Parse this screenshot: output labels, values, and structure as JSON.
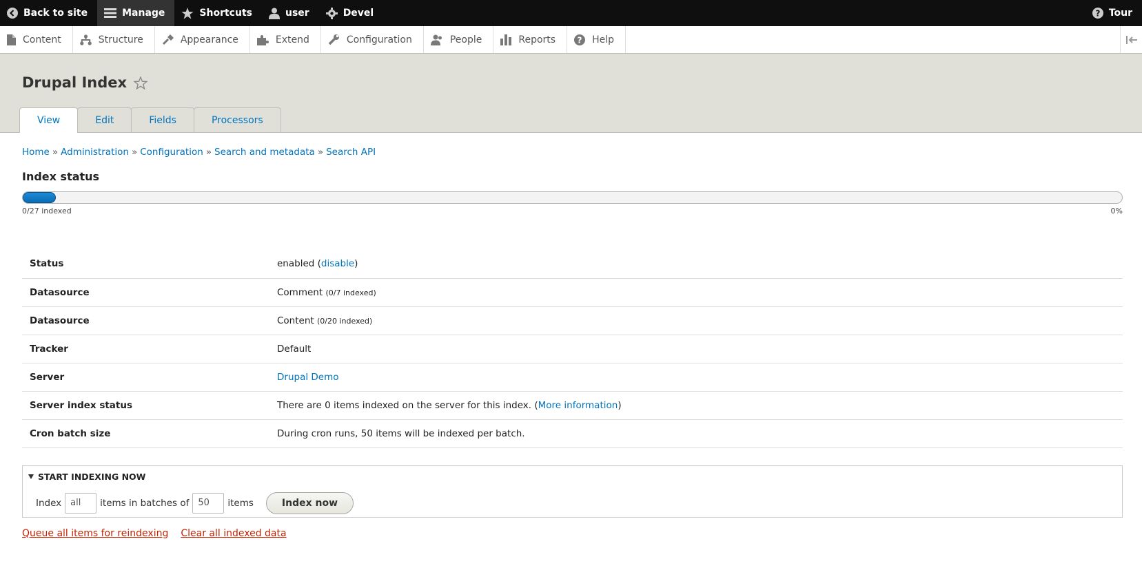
{
  "toolbar": {
    "back": "Back to site",
    "manage": "Manage",
    "shortcuts": "Shortcuts",
    "user": "user",
    "devel": "Devel",
    "tour": "Tour"
  },
  "tray": {
    "items": [
      "Content",
      "Structure",
      "Appearance",
      "Extend",
      "Configuration",
      "People",
      "Reports",
      "Help"
    ]
  },
  "page": {
    "title": "Drupal Index",
    "tabs": [
      "View",
      "Edit",
      "Fields",
      "Processors"
    ]
  },
  "breadcrumb": [
    "Home",
    "Administration",
    "Configuration",
    "Search and metadata",
    "Search API"
  ],
  "index_status": {
    "heading": "Index status",
    "progress_fraction": 0,
    "indexed_label": "0/27 indexed",
    "percent_label": "0%"
  },
  "info_rows": {
    "status": {
      "label": "Status",
      "value": "enabled",
      "link": "disable"
    },
    "datasource1": {
      "label": "Datasource",
      "value": "Comment",
      "note": "(0/7 indexed)"
    },
    "datasource2": {
      "label": "Datasource",
      "value": "Content",
      "note": "(0/20 indexed)"
    },
    "tracker": {
      "label": "Tracker",
      "value": "Default"
    },
    "server": {
      "label": "Server",
      "link": "Drupal Demo"
    },
    "server_index_status": {
      "label": "Server index status",
      "value": "There are 0 items indexed on the server for this index.",
      "link": "More information"
    },
    "cron": {
      "label": "Cron batch size",
      "value": "During cron runs, 50 items will be indexed per batch."
    }
  },
  "indexing": {
    "legend": "Start indexing now",
    "index_label": "Index",
    "index_value": "all",
    "batches_label": "items in batches of",
    "batch_value": "50",
    "items_label": "items",
    "button": "Index now"
  },
  "actions": {
    "queue": "Queue all items for reindexing",
    "clear": "Clear all indexed data"
  }
}
